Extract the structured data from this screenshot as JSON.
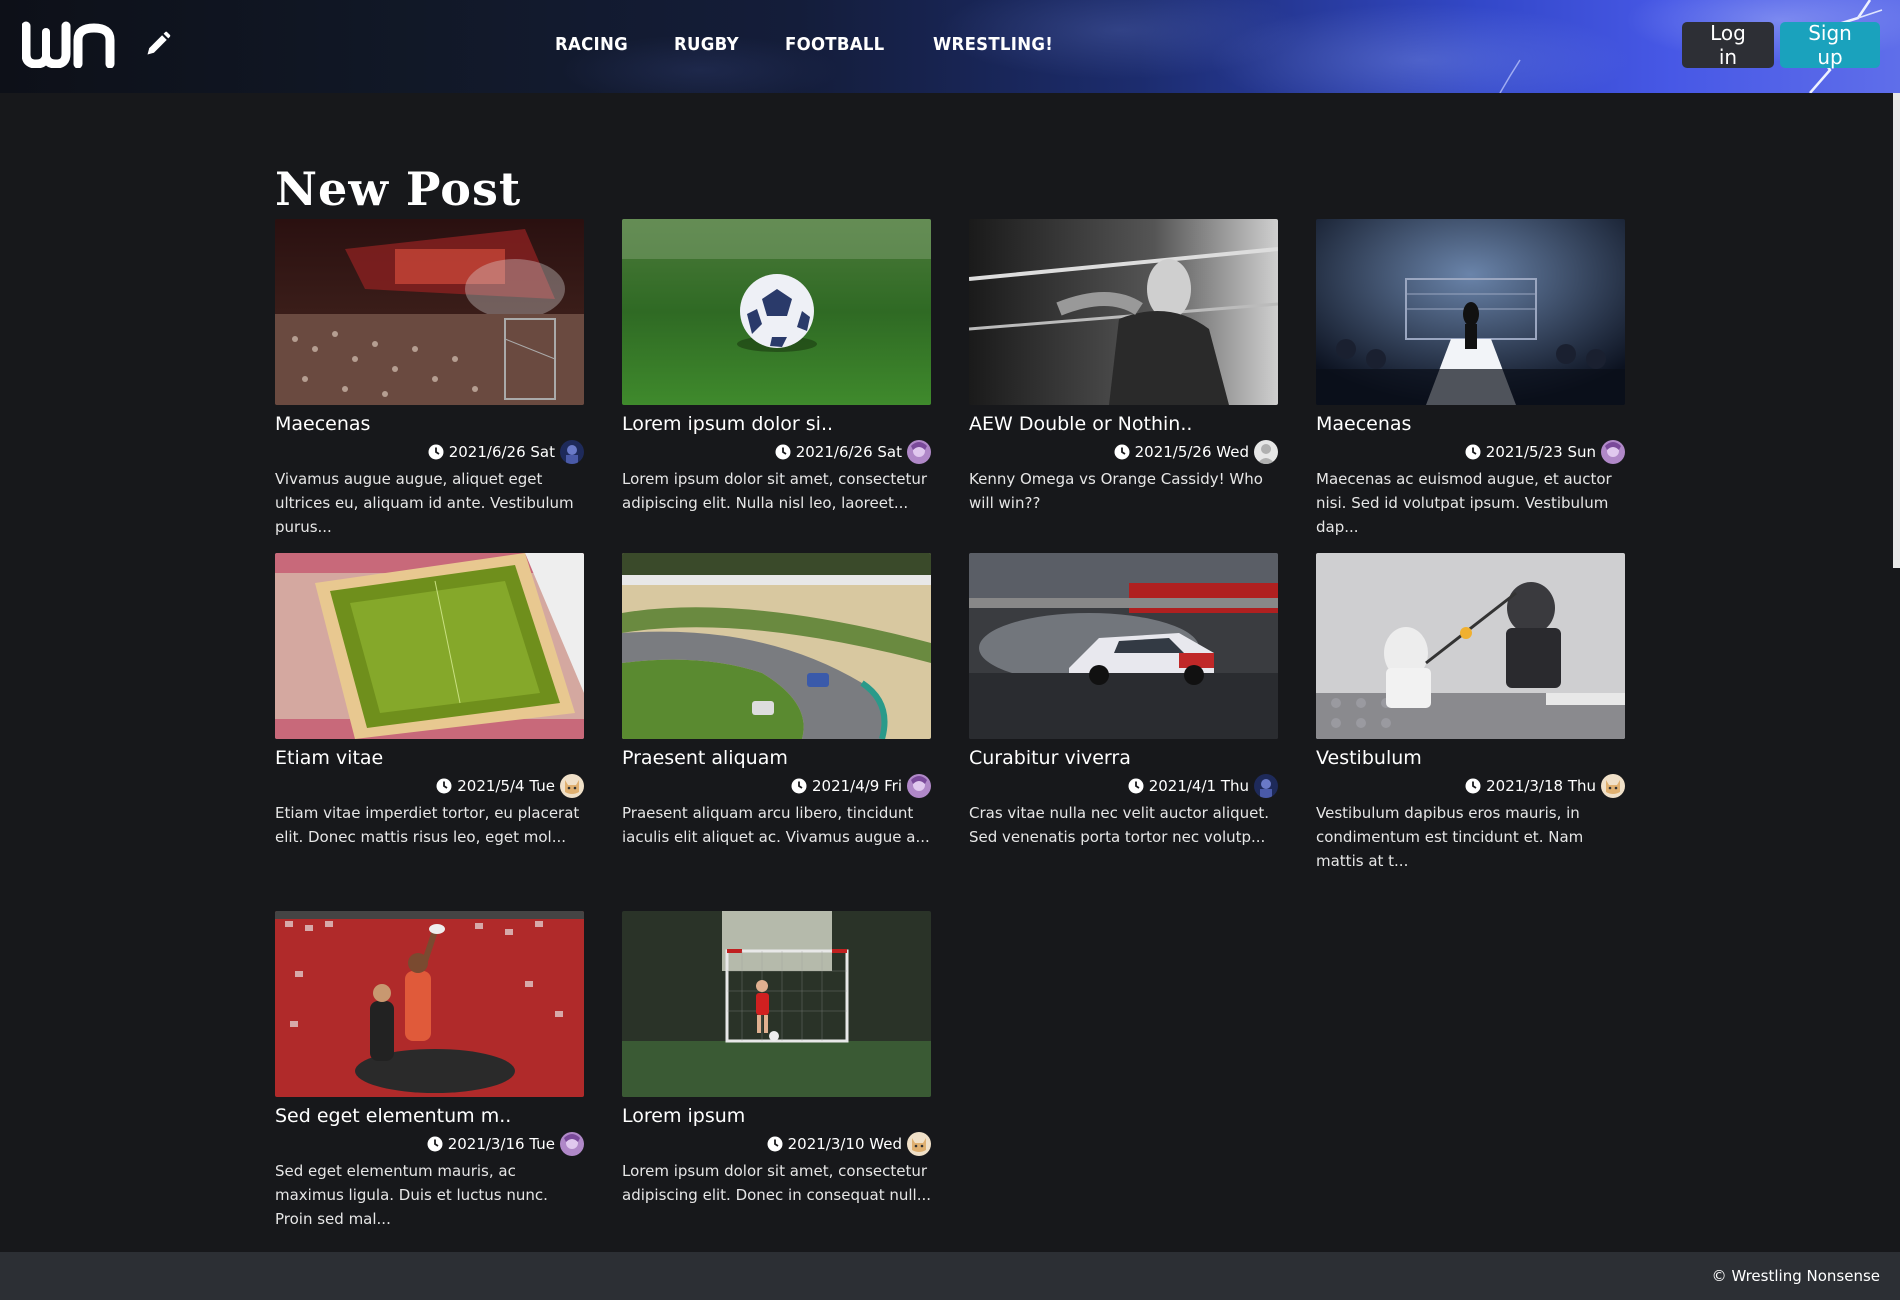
{
  "header": {
    "logo_text": "wn",
    "nav": [
      "RACING",
      "RUGBY",
      "FOOTBALL",
      "WRESTLING!"
    ],
    "login_label": "Log in",
    "signup_label": "Sign up"
  },
  "main": {
    "title": "New Post",
    "posts": [
      {
        "title": "Maecenas",
        "date": "2021/6/26 Sat",
        "excerpt": "Vivamus augue augue, aliquet eget ultrices eu, aliquam id ante. Vestibulum purus...",
        "thumb": "concert",
        "avatar": "blue"
      },
      {
        "title": "Lorem ipsum dolor si..",
        "date": "2021/6/26 Sat",
        "excerpt": "Lorem ipsum dolor sit amet, consectetur adipiscing elit. Nulla nisl leo, laoreet...",
        "thumb": "soccer-ball",
        "avatar": "purple"
      },
      {
        "title": "AEW Double or Nothin..",
        "date": "2021/5/26 Wed",
        "excerpt": "Kenny Omega vs Orange Cassidy! Who will win??",
        "thumb": "wrestler-bw",
        "avatar": "grey"
      },
      {
        "title": "Maecenas",
        "date": "2021/5/23 Sun",
        "excerpt": "Maecenas ac euismod augue, et auctor nisi. Sed id volutpat ipsum. Vestibulum dap...",
        "thumb": "ring-entrance",
        "avatar": "purple"
      },
      {
        "title": "Etiam vitae",
        "date": "2021/5/4 Tue",
        "excerpt": "Etiam vitae imperdiet tortor, eu placerat elit. Donec mattis risus leo, eget mol...",
        "thumb": "stadium-aerial",
        "avatar": "cat"
      },
      {
        "title": "Praesent aliquam",
        "date": "2021/4/9 Fri",
        "excerpt": "Praesent aliquam arcu libero, tincidunt iaculis elit aliquet ac. Vivamus augue a...",
        "thumb": "race-track",
        "avatar": "purple"
      },
      {
        "title": "Curabitur viverra",
        "date": "2021/4/1 Thu",
        "excerpt": "Cras vitae nulla nec velit auctor aliquet. Sed venenatis porta tortor nec volutp...",
        "thumb": "drift-car",
        "avatar": "blue"
      },
      {
        "title": "Vestibulum",
        "date": "2021/3/18 Thu",
        "excerpt": "Vestibulum dapibus eros mauris, in condimentum est tincidunt et. Nam mattis at t...",
        "thumb": "lego-fencing",
        "avatar": "cat"
      },
      {
        "title": "Sed eget elementum m..",
        "date": "2021/3/16 Tue",
        "excerpt": "Sed eget elementum mauris, ac maximus ligula. Duis et luctus nunc. Proin sed mal...",
        "thumb": "rugby-lineout",
        "avatar": "purple"
      },
      {
        "title": "Lorem ipsum",
        "date": "2021/3/10 Wed",
        "excerpt": "Lorem ipsum dolor sit amet, consectetur adipiscing elit. Donec in consequat null...",
        "thumb": "kid-goal",
        "avatar": "cat"
      }
    ]
  },
  "footer": {
    "copyright": "© Wrestling Nonsense"
  },
  "colors": {
    "background": "#17181b",
    "footer": "#2c2f34",
    "login_button": "#2d2f35",
    "signup_button": "#1aa2bd"
  }
}
